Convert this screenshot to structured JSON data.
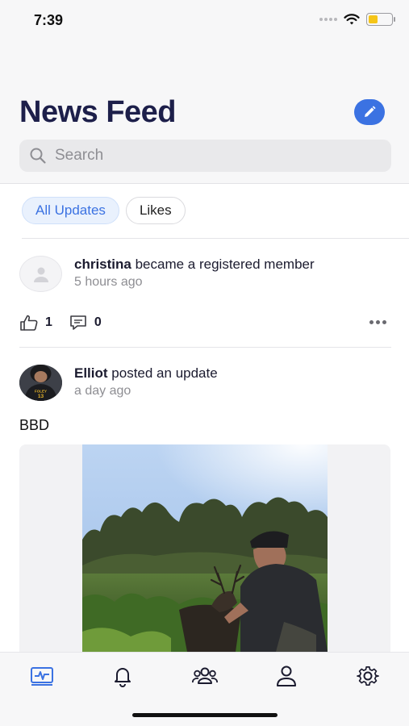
{
  "status_bar": {
    "time": "7:39"
  },
  "header": {
    "title": "News Feed",
    "search_placeholder": "Search"
  },
  "filters": [
    {
      "label": "All Updates",
      "active": true
    },
    {
      "label": "Likes",
      "active": false
    }
  ],
  "posts": [
    {
      "author": "christina",
      "action": "became a registered member",
      "time": "5 hours ago",
      "likes": "1",
      "comments": "0"
    },
    {
      "author": "Elliot",
      "action": "posted an update",
      "time": "a day ago",
      "body": "BBD",
      "avatar_jersey_text": "FOLEY 13"
    }
  ],
  "tabbar": {
    "items": [
      "activity-icon",
      "bell-icon",
      "group-icon",
      "person-icon",
      "gear-icon"
    ],
    "active": "activity-icon"
  },
  "colors": {
    "accent": "#3b72e2",
    "title": "#1d1f4a",
    "muted": "#8e8e93"
  }
}
